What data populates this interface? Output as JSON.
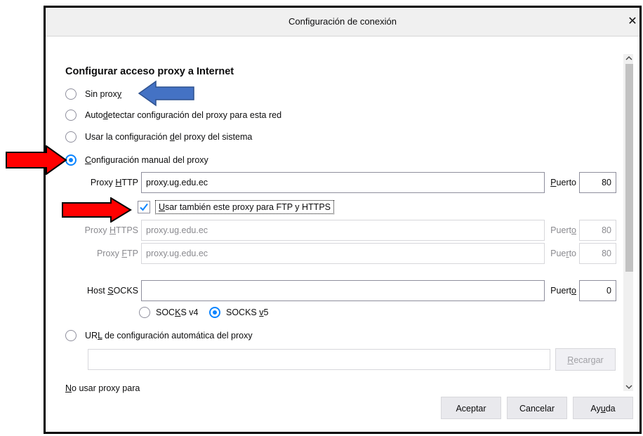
{
  "dialog": {
    "title": "Configuración de conexión",
    "close_glyph": "✕",
    "heading": "Configurar acceso proxy a Internet",
    "options": {
      "no_proxy": {
        "pre": "Sin prox",
        "u": "y",
        "post": ""
      },
      "auto_detect": {
        "pre": "Auto",
        "u": "d",
        "post": "etectar configuración del proxy para esta red"
      },
      "system": {
        "pre": "Usar la configuración ",
        "u": "d",
        "post": "el proxy del sistema"
      },
      "manual": {
        "pre": "",
        "u": "C",
        "post": "onfiguración manual del proxy"
      },
      "auto_url": {
        "pre": "UR",
        "u": "L",
        "post": " de configuración automática del proxy"
      }
    },
    "http": {
      "label_pre": "Proxy ",
      "label_u": "H",
      "label_post": "TTP",
      "value": "proxy.ug.edu.ec",
      "port_label_u": "P",
      "port_label_post": "uerto",
      "port": "80"
    },
    "share_checkbox": {
      "pre": "",
      "u": "U",
      "post": "sar también este proxy para FTP y HTTPS",
      "checked": true
    },
    "https": {
      "label_pre": "Proxy ",
      "label_u": "H",
      "label_post": "TTPS",
      "value": "proxy.ug.edu.ec",
      "port_label_pre": "Puert",
      "port_label_u": "o",
      "port": "80"
    },
    "ftp": {
      "label_pre": "Proxy ",
      "label_u": "F",
      "label_post": "TP",
      "value": "proxy.ug.edu.ec",
      "port_label_pre": "Pue",
      "port_label_u": "r",
      "port_label_post": "to",
      "port": "80"
    },
    "socks": {
      "label_pre": "Host ",
      "label_u": "S",
      "label_post": "OCKS",
      "value": "",
      "port_label_pre": "Puert",
      "port_label_u": "o",
      "port": "0",
      "v4_pre": "SOC",
      "v4_u": "K",
      "v4_post": "S v4",
      "v5_pre": "SOCKS ",
      "v5_u": "v",
      "v5_post": "5"
    },
    "reload": {
      "u": "R",
      "post": "ecargar"
    },
    "no_proxy_for": {
      "u": "N",
      "post": "o usar proxy para"
    },
    "buttons": {
      "accept": "Aceptar",
      "cancel": "Cancelar",
      "help_pre": "Ay",
      "help_u": "u",
      "help_post": "da"
    },
    "accent_color": "#0a84ff",
    "arrow_blue": "#4472c4",
    "arrow_red": "#ff0000"
  }
}
